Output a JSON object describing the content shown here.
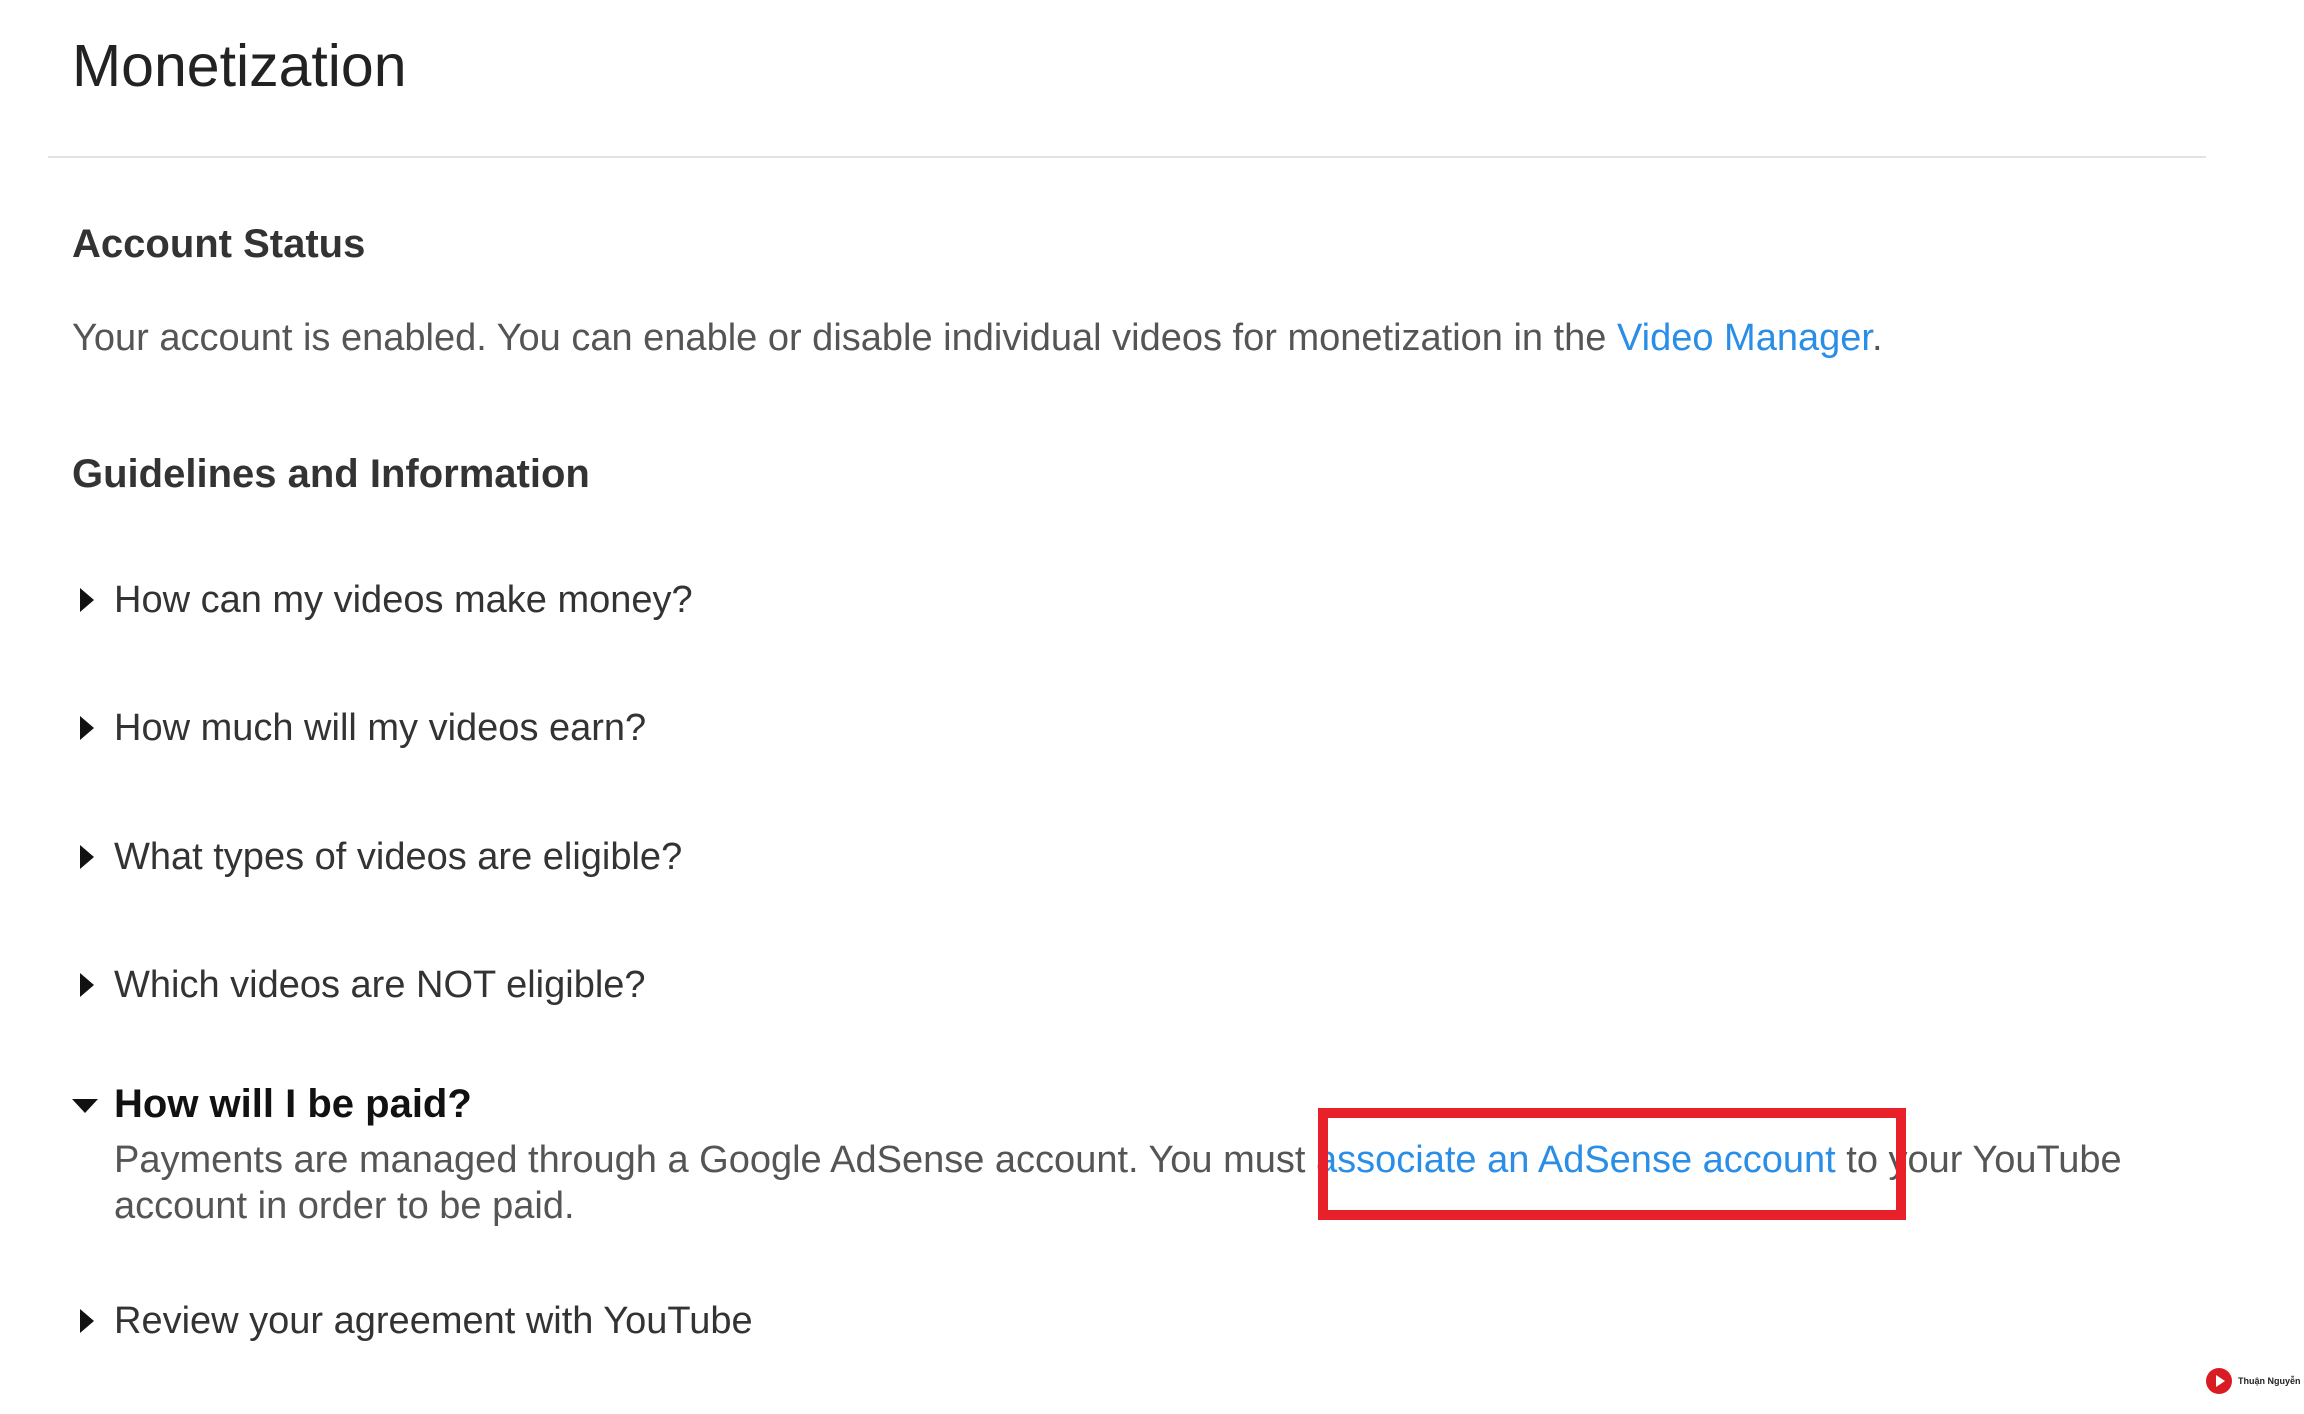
{
  "page": {
    "title": "Monetization"
  },
  "account_status": {
    "heading": "Account Status",
    "text_before_link": "Your account is enabled. You can enable or disable individual videos for monetization in the ",
    "link_text": "Video Manager",
    "text_after_link": "."
  },
  "guidelines": {
    "heading": "Guidelines and Information",
    "items": [
      {
        "label": "How can my videos make money?",
        "expanded": false
      },
      {
        "label": "How much will my videos earn?",
        "expanded": false
      },
      {
        "label": "What types of videos are eligible?",
        "expanded": false
      },
      {
        "label": "Which videos are NOT eligible?",
        "expanded": false
      },
      {
        "label": "How will I be paid?",
        "expanded": true
      },
      {
        "label": "Review your agreement with YouTube",
        "expanded": false
      }
    ],
    "paid_answer": {
      "text_before_link": "Payments are managed through a Google AdSense account. You must ",
      "link_text": "associate an AdSense account",
      "text_after_link": " to your YouTube account in order to be paid."
    }
  },
  "annotation": {
    "highlight_color": "#e8202a"
  },
  "colors": {
    "link": "#2a8ee6",
    "heading": "#333333",
    "body_text": "#555555"
  },
  "watermark": {
    "icon": "play-logo-icon",
    "text": "Thuận Nguyễn"
  }
}
